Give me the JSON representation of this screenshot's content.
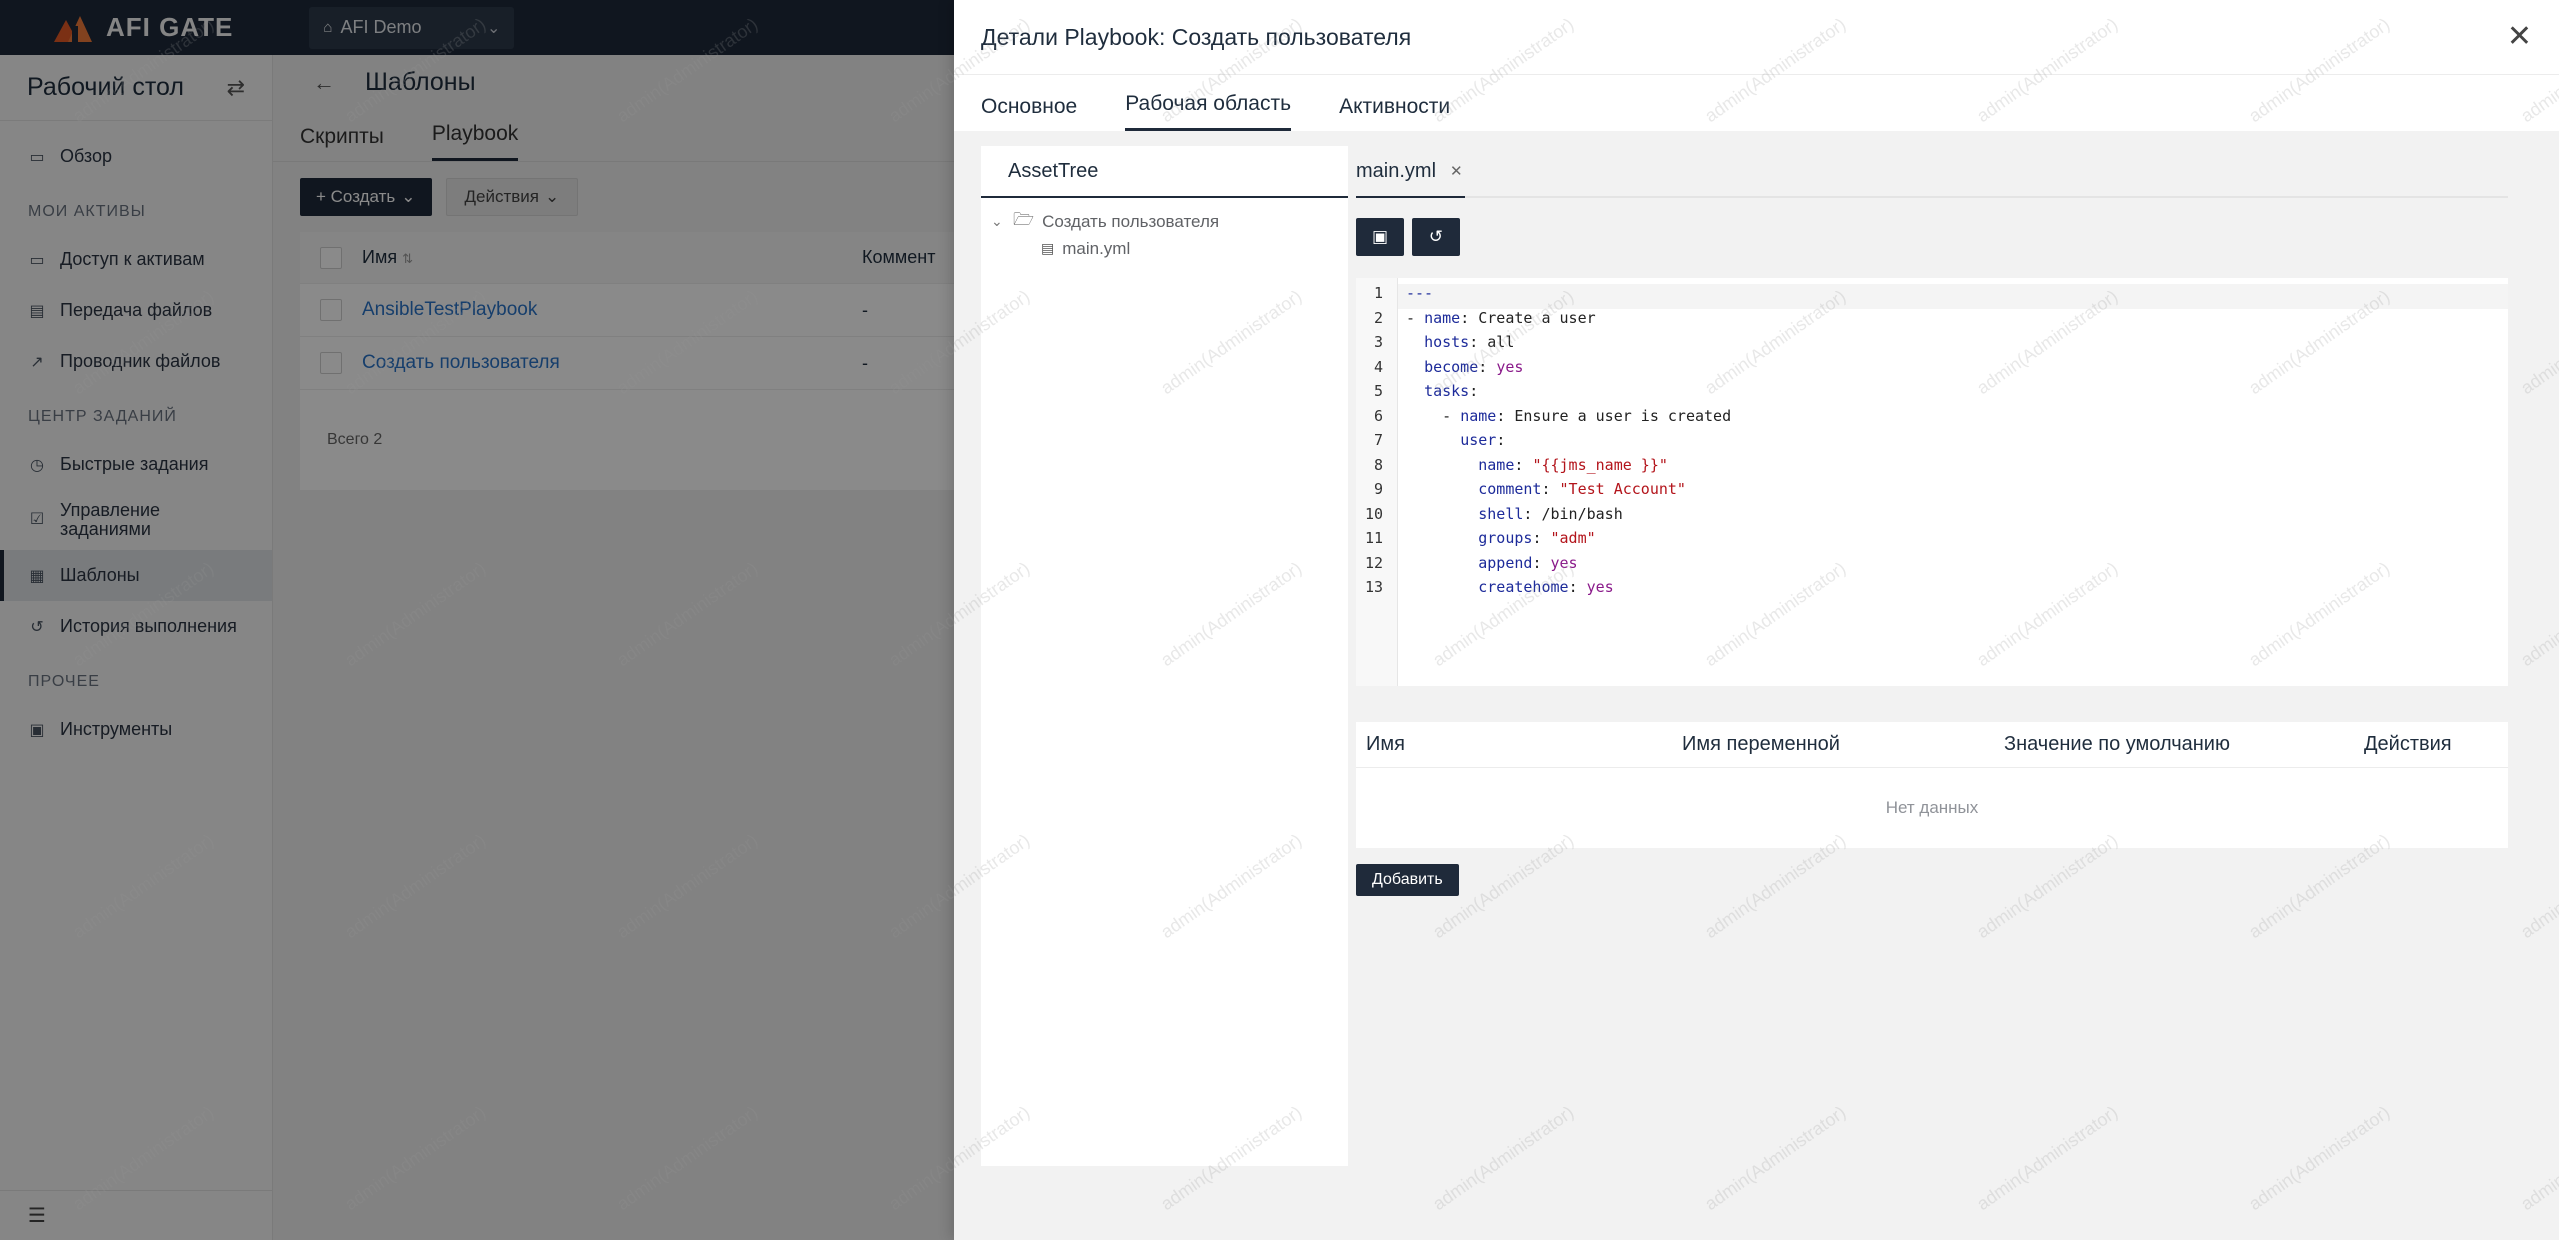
{
  "topbar": {
    "logo_text": "AFI GATE",
    "org": "AFI Demo"
  },
  "sidebar": {
    "title": "Рабочий стол",
    "items_top": [
      {
        "label": "Обзор",
        "icon": "monitor-icon"
      }
    ],
    "section1": "МОИ АКТИВЫ",
    "items_assets": [
      {
        "label": "Доступ к активам",
        "icon": "monitor-icon"
      },
      {
        "label": "Передача файлов",
        "icon": "file-transfer-icon"
      },
      {
        "label": "Проводник файлов",
        "icon": "external-link-icon"
      }
    ],
    "section2": "ЦЕНТР ЗАДАНИЙ",
    "items_jobs": [
      {
        "label": "Быстрые задания",
        "icon": "clock-icon"
      },
      {
        "label": "Управление заданиями",
        "icon": "calendar-check-icon"
      },
      {
        "label": "Шаблоны",
        "icon": "table-icon"
      },
      {
        "label": "История выполнения",
        "icon": "history-icon"
      }
    ],
    "section3": "ПРОЧЕЕ",
    "items_other": [
      {
        "label": "Инструменты",
        "icon": "briefcase-icon"
      }
    ]
  },
  "page": {
    "title": "Шаблоны",
    "tabs": [
      "Скрипты",
      "Playbook"
    ],
    "create_label": "+ Создать",
    "actions_label": "Действия",
    "table": {
      "headers": [
        "Имя",
        "Коммент"
      ],
      "rows": [
        {
          "name": "AnsibleTestPlaybook",
          "comment": "-"
        },
        {
          "name": "Создать пользователя",
          "comment": "-"
        }
      ],
      "total": "Всего 2"
    }
  },
  "drawer": {
    "title": "Детали Playbook: Создать пользователя",
    "tabs": [
      "Основное",
      "Рабочая область",
      "Активности"
    ],
    "tree": {
      "tab_label": "AssetTree",
      "folder": "Создать пользователя",
      "file": "main.yml"
    },
    "editor": {
      "file_tab": "main.yml",
      "code_lines": [
        "---",
        "- name: Create a user",
        "  hosts: all",
        "  become: yes",
        "  tasks:",
        "    - name: Ensure a user is created",
        "      user:",
        "        name: \"{{jms_name }}\"",
        "        comment: \"Test Account\"",
        "        shell: /bin/bash",
        "        groups: \"adm\"",
        "        append: yes",
        "        createhome: yes"
      ]
    },
    "vars_table": {
      "headers": [
        "Имя",
        "Имя переменной",
        "Значение по умолчанию",
        "Действия"
      ],
      "empty": "Нет данных",
      "add_label": "Добавить"
    }
  },
  "watermark": "admin(Administrator)",
  "colors": {
    "dark": "#1f2a3a",
    "link": "#2a74c7",
    "accent_logo": "#e35a25"
  }
}
